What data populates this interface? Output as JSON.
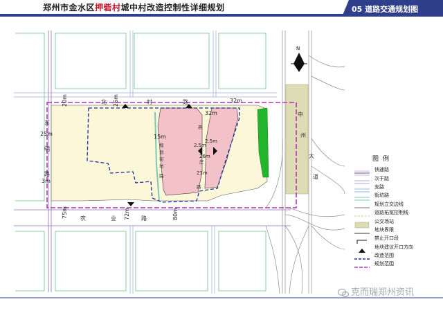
{
  "header": {
    "title_pre": "郑州市金水区",
    "title_highlight": "押砦村",
    "title_post": "城中村改造控制性详细规划",
    "sheet": "05 道路交通规划图"
  },
  "map": {
    "north_label": "N",
    "road_labels": {
      "north": [
        "北",
        "村",
        "路"
      ],
      "east": [
        "中",
        "州",
        "大",
        "道"
      ],
      "south": [
        "农",
        "业",
        "路"
      ],
      "west": [
        "东",
        "明",
        "路"
      ],
      "plan_street": [
        "规",
        "划",
        "街",
        "坊",
        "路"
      ],
      "mid_road": [
        "燕",
        "庄",
        "路"
      ]
    },
    "dimensions": {
      "d20": "20m",
      "d26": "26m",
      "d32a": "32m",
      "d32b": "32m",
      "d25": "25m",
      "d15": "15m",
      "d3": "3m",
      "d75": "75m",
      "d72": "72m",
      "d80": "80m",
      "d2a": "2.5m",
      "d2b": "2.5m",
      "d26b": "26m",
      "d21": "21m"
    }
  },
  "legend": {
    "title": "图例",
    "items": [
      {
        "label": "快速路",
        "icon": "expressway-line"
      },
      {
        "label": "次干路",
        "icon": "secondary-road-line"
      },
      {
        "label": "支路",
        "icon": "branch-road-line"
      },
      {
        "label": "街坊路",
        "icon": "block-road-line"
      },
      {
        "label": "规划立交边线",
        "icon": "interchange-edge-line"
      },
      {
        "label": "道路拓宽控制线",
        "icon": "widening-control-line"
      },
      {
        "label": "公交场站",
        "icon": "bus-station-fill"
      },
      {
        "label": "地块界限",
        "icon": "plot-boundary-line"
      },
      {
        "label": "禁止开口段",
        "icon": "no-opening-symbol"
      },
      {
        "label": "地块建议开口方向",
        "icon": "opening-direction-arrow"
      },
      {
        "label": "改造范围",
        "icon": "renovation-boundary-dashed"
      },
      {
        "label": "规划范围",
        "icon": "planning-boundary-dashed"
      }
    ],
    "colors": {
      "expressway": "#8a6bb8",
      "secondary": "#a8a8d8",
      "branch": "#9ab8dc",
      "block": "#7cc8b8",
      "interchange": "#777777",
      "widening": "#c8c890",
      "bus_station": "#dedcb4",
      "plot": "#333333",
      "renovation": "#1c2a9c",
      "planning": "#b433b4"
    }
  },
  "watermark": "克而瑞郑州资讯"
}
